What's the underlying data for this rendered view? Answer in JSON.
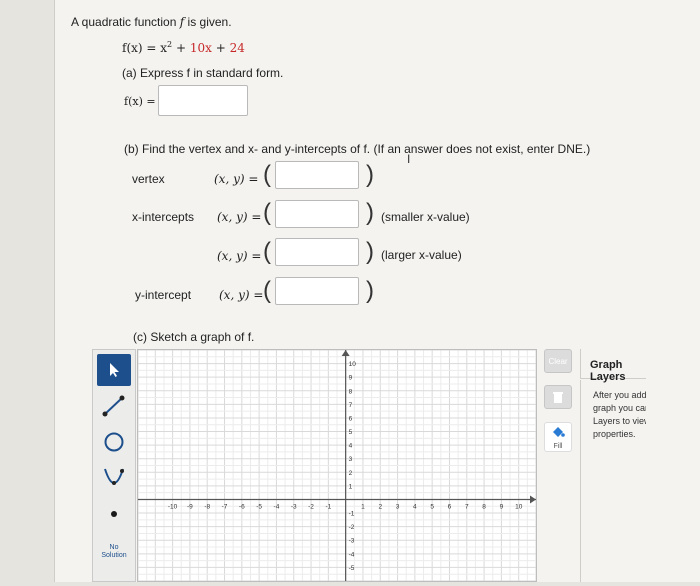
{
  "problem": {
    "intro_pre": "A quadratic function ",
    "intro_var": "f",
    "intro_post": " is given.",
    "eq_lhs": "f(x) = ",
    "eq_x": "x",
    "eq_exp": "2",
    "eq_plus1": " + ",
    "eq_10x": "10x",
    "eq_plus2": " + ",
    "eq_24": "24"
  },
  "part_a": {
    "label": "(a) Express f in standard form.",
    "answer_label": "f(x) =",
    "answer_value": ""
  },
  "part_b": {
    "label": "(b) Find the vertex and x- and y-intercepts of f. (If an answer does not exist, enter DNE.)",
    "vertex_label": "vertex",
    "x_int_label": "x-intercepts",
    "y_int_label": "y-intercept",
    "xy_label": "(x, y) =",
    "paren_open": "(",
    "paren_close": ")",
    "smaller_note": "(smaller x-value)",
    "larger_note": "(larger x-value)",
    "vertex_value": "",
    "x_int_small_value": "",
    "x_int_large_value": "",
    "y_int_value": ""
  },
  "part_c": {
    "label": "(c) Sketch a graph of f.",
    "no_solution_label": "No Solution",
    "fill_label": "Fill",
    "clear_label": "Clear",
    "layers_title": "Graph Layers",
    "layers_help": "After you add an object to the graph you can use Graph Layers to view and edit its properties."
  },
  "chart_data": {
    "type": "scatter",
    "x_ticks": [
      "-10",
      "-9",
      "-8",
      "-7",
      "-6",
      "-5",
      "-4",
      "-3",
      "-2",
      "-1",
      "1",
      "2",
      "3",
      "4",
      "5",
      "6",
      "7",
      "8",
      "9",
      "10"
    ],
    "y_ticks": [
      "10",
      "9",
      "8",
      "7",
      "6",
      "5",
      "4",
      "3",
      "2",
      "1",
      "-1",
      "-2",
      "-3",
      "-4",
      "-5"
    ],
    "xlim": [
      -12,
      11
    ],
    "ylim": [
      -6,
      11
    ],
    "grid": true,
    "series": []
  },
  "colors": {
    "accent": "#1d4f8c",
    "red": "#c62828",
    "grid": "#d9d9d9"
  }
}
